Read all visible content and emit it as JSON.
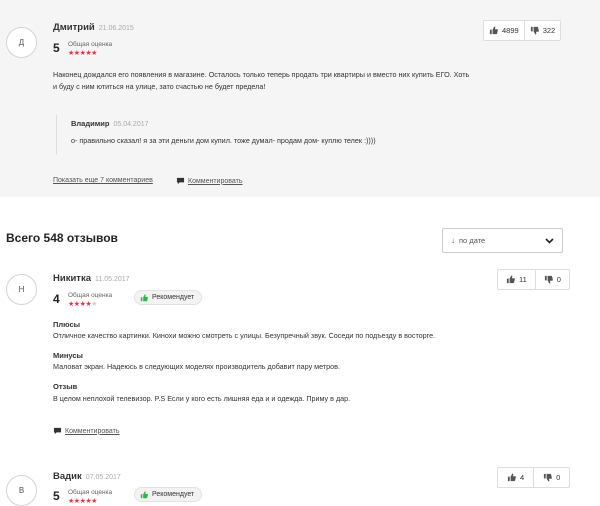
{
  "pinned_review": {
    "avatar_letter": "Д",
    "author": "Дмитрий",
    "date": "21.06.2015",
    "score": "5",
    "score_label": "Общая оценка",
    "stars_filled": 5,
    "likes": "4899",
    "dislikes": "322",
    "text_line1": "Наконец дождался его появления в магазине. Осталось только теперь продать три квартиры и вместо них купить ЕГО. Хоть",
    "text_line2": "и буду с ним ютиться на улице, зато счастью не будет предела!",
    "reply": {
      "author": "Владимир",
      "date": "05.04.2017",
      "text": "о- правильно сказал! я за эти деньги дом купил. тоже думал- продам дом- куплю телек :))))"
    },
    "more_comments": "Показать еще 7 комментариев",
    "comment_link": "Комментировать"
  },
  "reviews_header": {
    "title": "Всего 548 отзывов",
    "sort_label": "по дате"
  },
  "reviews": [
    {
      "avatar_letter": "Н",
      "author": "Никитка",
      "date": "11.05.2017",
      "score": "4",
      "score_label": "Общая оценка",
      "stars_filled": 4,
      "recommend": "Рекомендует",
      "likes": "11",
      "dislikes": "0",
      "pros_title": "Плюсы",
      "pros": "Отличное качество картинки. Кинохи можно смотреть с улицы. Безупречный звук. Соседи по подъезду в восторге.",
      "cons_title": "Минусы",
      "cons": "Маловат экран. Надеюсь в следующих моделях производитель добавит пару метров.",
      "review_title": "Отзыв",
      "review": "В целом неплохой телевизор. P.S Если у кого есть лишняя еда и и одежда. Приму в дар.",
      "comment_link": "Комментировать"
    },
    {
      "avatar_letter": "В",
      "author": "Вадик",
      "date": "07.05.2017",
      "score": "5",
      "score_label": "Общая оценка",
      "stars_filled": 5,
      "recommend": "Рекомендует",
      "likes": "4",
      "dislikes": "0"
    }
  ],
  "icons": {
    "thumb_up": "thumbs-up-icon",
    "thumb_down": "thumbs-down-icon",
    "comment": "comment-icon",
    "recommend": "thumbs-up-green-icon",
    "sort_arrow": "arrow-down-icon",
    "chevron": "chevron-down-icon"
  },
  "colors": {
    "star": "#e8324a",
    "recommend_green": "#2db84b",
    "pinned_bg": "#f5f5f5"
  }
}
